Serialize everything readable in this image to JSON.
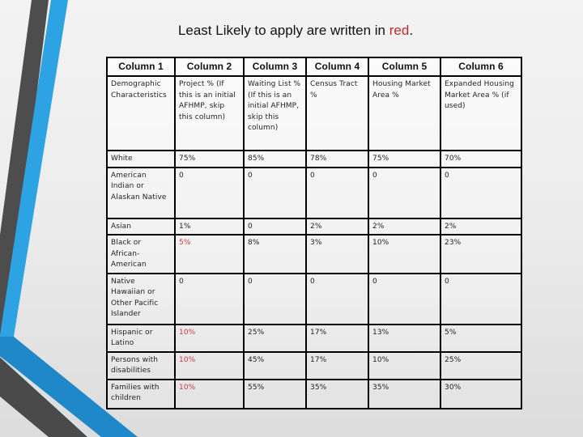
{
  "title": {
    "prefix": "Least Likely to apply are written in ",
    "highlight": "red",
    "suffix": ".",
    "highlight_color": "#c0282d"
  },
  "table": {
    "headers": [
      "Column 1",
      "Column 2",
      "Column 3",
      "Column 4",
      "Column 5",
      "Column 6"
    ],
    "descriptions": [
      "Demographic Characteristics",
      "Project % (If this is an initial AFHMP, skip this column)",
      "Waiting List % (If this is an initial AFHMP, skip this column)",
      "Census Tract %",
      "Housing Market Area %",
      "Expanded Housing Market Area % (if used)"
    ],
    "rows": [
      {
        "label": "White",
        "values": [
          "75%",
          "85%",
          "78%",
          "75%",
          "70%"
        ],
        "red": [
          false,
          false,
          false,
          false,
          false
        ]
      },
      {
        "label": "American Indian or Alaskan Native",
        "values": [
          "0",
          "0",
          "0",
          "0",
          "0"
        ],
        "red": [
          false,
          false,
          false,
          false,
          false
        ]
      },
      {
        "label": "Asian",
        "values": [
          "1%",
          "0",
          "2%",
          "2%",
          "2%"
        ],
        "red": [
          false,
          false,
          false,
          false,
          false
        ]
      },
      {
        "label": "Black or African-American",
        "values": [
          "5%",
          "8%",
          "3%",
          "10%",
          "23%"
        ],
        "red": [
          true,
          false,
          false,
          false,
          false
        ]
      },
      {
        "label": "Native Hawaiian or Other Pacific Islander",
        "values": [
          "0",
          "0",
          "0",
          "0",
          "0"
        ],
        "red": [
          false,
          false,
          false,
          false,
          false
        ]
      },
      {
        "label": "Hispanic or Latino",
        "values": [
          "10%",
          "25%",
          "17%",
          "13%",
          "5%"
        ],
        "red": [
          true,
          false,
          false,
          false,
          false
        ]
      },
      {
        "label": "Persons with disabilities",
        "values": [
          "10%",
          "45%",
          "17%",
          "10%",
          "25%"
        ],
        "red": [
          true,
          false,
          false,
          false,
          false
        ]
      },
      {
        "label": "Families with children",
        "values": [
          "10%",
          "55%",
          "35%",
          "35%",
          "30%"
        ],
        "red": [
          true,
          false,
          false,
          false,
          false
        ]
      }
    ]
  },
  "decoration": {
    "stripe_colors": {
      "dark": "#4a4a4a",
      "blue_light": "#2ea3e3",
      "blue_dark": "#1e88c8"
    }
  }
}
